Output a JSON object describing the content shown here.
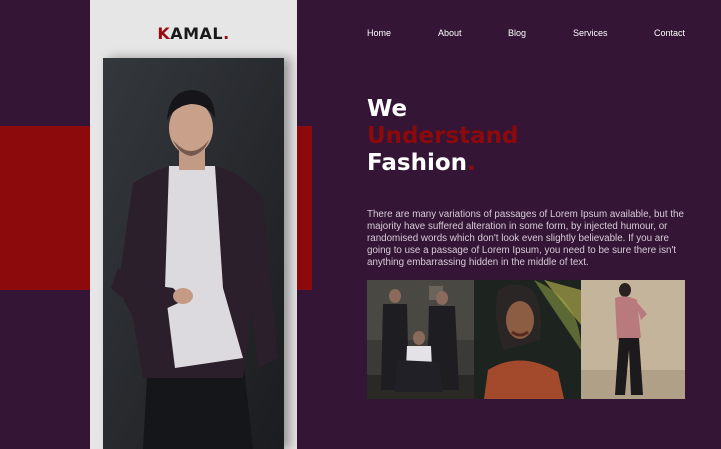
{
  "brand": {
    "prefix": "K",
    "rest": "AMAL",
    "dot": "."
  },
  "nav": {
    "items": [
      "Home",
      "About",
      "Blog",
      "Services",
      "Contact"
    ]
  },
  "hero": {
    "line1": "We",
    "line2": "Understand",
    "line3": "Fashion",
    "line3_dot": "."
  },
  "description": "There are many variations of passages of Lorem Ipsum available, but the majority have suffered alteration in some form, by injected humour, or randomised words which don't look even slightly believable. If you are going to use a passage of Lorem Ipsum, you need to be sure there isn't anything embarrassing hidden in the middle of text.",
  "colors": {
    "background": "#341535",
    "accent_red": "#8d0a0c",
    "sidebar": "#e7e6e7"
  }
}
